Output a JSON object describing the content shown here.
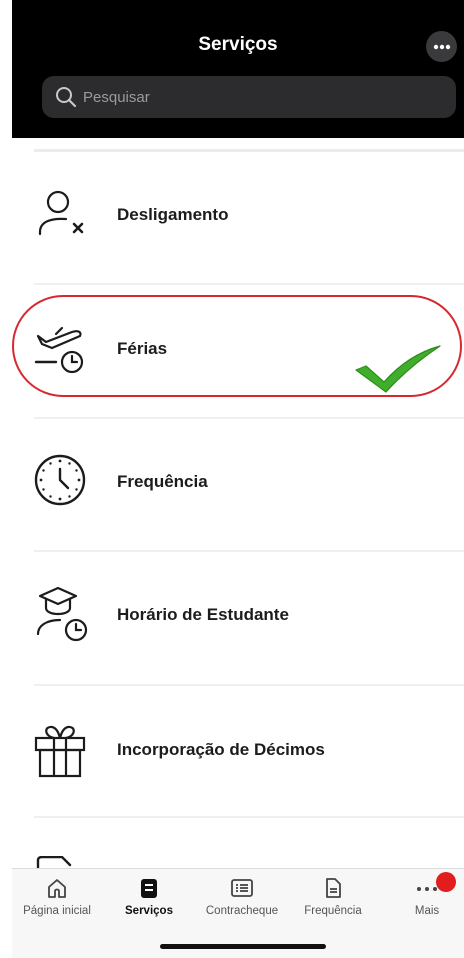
{
  "header": {
    "title": "Serviços",
    "more_icon": "ellipsis-icon",
    "search_placeholder": "Pesquisar"
  },
  "services": [
    {
      "label": "Desligamento",
      "icon": "user-remove-icon"
    },
    {
      "label": "Férias",
      "icon": "plane-clock-icon",
      "highlighted": true,
      "checkmark": true
    },
    {
      "label": "Frequência",
      "icon": "clock-icon"
    },
    {
      "label": "Horário de Estudante",
      "icon": "graduate-clock-icon"
    },
    {
      "label": "Incorporação de Décimos",
      "icon": "gift-icon"
    }
  ],
  "tabbar": {
    "tabs": [
      {
        "label": "Página inicial",
        "icon": "home-icon"
      },
      {
        "label": "Serviços",
        "icon": "services-icon",
        "active": true
      },
      {
        "label": "Contracheque",
        "icon": "list-icon"
      },
      {
        "label": "Frequência",
        "icon": "document-icon"
      },
      {
        "label": "Mais",
        "icon": "ellipsis-icon",
        "has_badge": true
      }
    ]
  },
  "colors": {
    "header_bg": "#000000",
    "highlight": "#d7282f",
    "check": "#3fae2a",
    "badge": "#e11d1d"
  }
}
